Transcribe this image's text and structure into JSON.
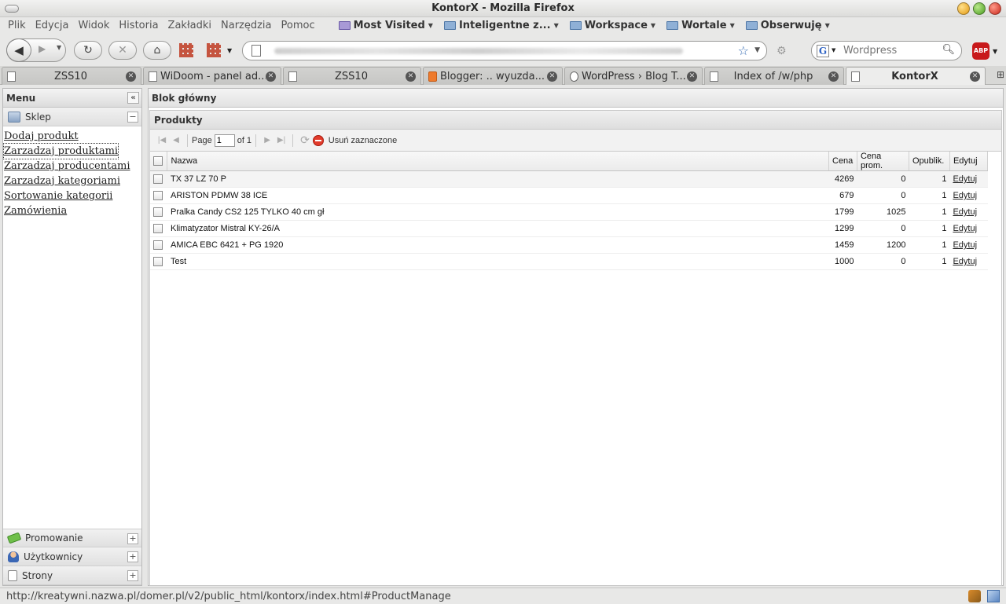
{
  "window": {
    "title": "KontorX - Mozilla Firefox"
  },
  "menubar": [
    "Plik",
    "Edycja",
    "Widok",
    "Historia",
    "Zakładki",
    "Narzędzia",
    "Pomoc"
  ],
  "bookmarks": [
    {
      "label": "Most Visited",
      "icon": "smart-folder-icon"
    },
    {
      "label": "Inteligentne z...",
      "icon": "folder-icon"
    },
    {
      "label": "Workspace",
      "icon": "folder-icon"
    },
    {
      "label": "Wortale",
      "icon": "folder-icon"
    },
    {
      "label": "Obserwuję",
      "icon": "folder-icon"
    }
  ],
  "search": {
    "placeholder": "Wordpress",
    "engine": "G"
  },
  "addon": {
    "label": "ABP"
  },
  "tabs": [
    {
      "label": "ZSS10",
      "icon": "page-icon"
    },
    {
      "label": "WiDoom - panel ad...",
      "icon": "page-icon"
    },
    {
      "label": "ZSS10",
      "icon": "page-icon"
    },
    {
      "label": "Blogger: .. wyuzda...",
      "icon": "blogger-icon"
    },
    {
      "label": "WordPress › Blog T...",
      "icon": "wordpress-icon"
    },
    {
      "label": "Index of /w/php",
      "icon": "page-icon"
    },
    {
      "label": "KontorX",
      "icon": "page-icon",
      "active": true
    }
  ],
  "sidebar": {
    "title": "Menu",
    "sections": {
      "sklep": {
        "label": "Sklep",
        "expanded": true
      },
      "promowanie": {
        "label": "Promowanie"
      },
      "uzytkownicy": {
        "label": "Użytkownicy"
      },
      "strony": {
        "label": "Strony"
      }
    },
    "links": [
      {
        "label": "Dodaj produkt"
      },
      {
        "label": "Zarzadzaj produktami"
      },
      {
        "label": "Zarzadzaj producentami"
      },
      {
        "label": "Zarzadzaj kategoriami"
      },
      {
        "label": "Sortowanie kategorii"
      },
      {
        "label": "Zamówienia"
      }
    ]
  },
  "main": {
    "title": "Blok główny",
    "grid": {
      "title": "Produkty",
      "pager": {
        "page_label": "Page",
        "page_value": "1",
        "of_label": "of 1",
        "delete_label": "Usuń zaznaczone"
      },
      "columns": [
        "Nazwa",
        "Cena",
        "Cena prom.",
        "Opublik.",
        "Edytuj"
      ],
      "rows": [
        {
          "nazwa": "TX 37 LZ 70 P",
          "cena": "4269",
          "cena_prom": "0",
          "opublik": "1",
          "edit": "Edytuj"
        },
        {
          "nazwa": "ARISTON PDMW 38 ICE",
          "cena": "679",
          "cena_prom": "0",
          "opublik": "1",
          "edit": "Edytuj"
        },
        {
          "nazwa": "Pralka Candy CS2 125 TYLKO 40 cm gł",
          "cena": "1799",
          "cena_prom": "1025",
          "opublik": "1",
          "edit": "Edytuj"
        },
        {
          "nazwa": "Klimatyzator Mistral KY-26/A",
          "cena": "1299",
          "cena_prom": "0",
          "opublik": "1",
          "edit": "Edytuj"
        },
        {
          "nazwa": "AMICA EBC 6421 + PG 1920",
          "cena": "1459",
          "cena_prom": "1200",
          "opublik": "1",
          "edit": "Edytuj"
        },
        {
          "nazwa": "Test",
          "cena": "1000",
          "cena_prom": "0",
          "opublik": "1",
          "edit": "Edytuj"
        }
      ]
    }
  },
  "statusbar": {
    "text": "http://kreatywni.nazwa.pl/domer.pl/v2/public_html/kontorx/index.html#ProductManage"
  }
}
